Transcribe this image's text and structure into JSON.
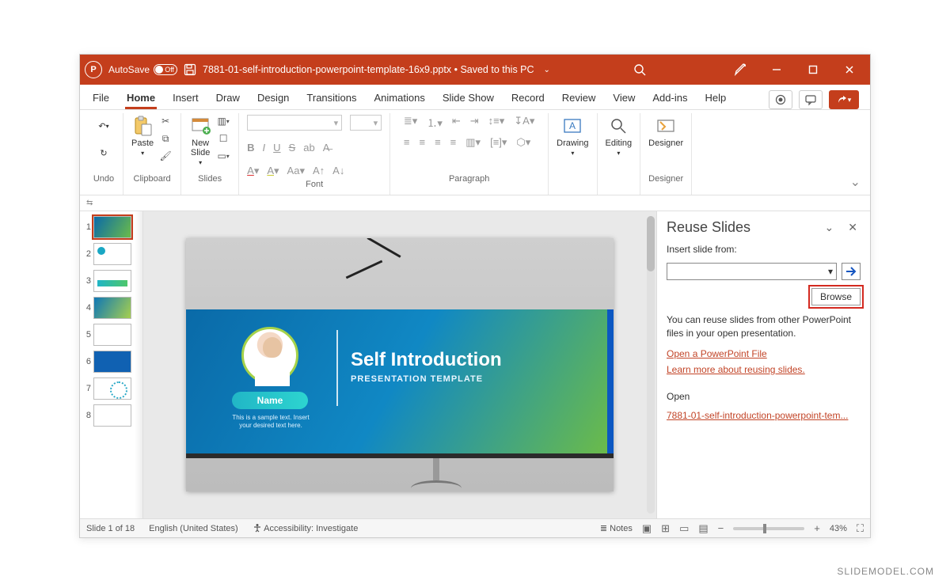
{
  "titlebar": {
    "autosave_label": "AutoSave",
    "autosave_state": "Off",
    "filename": "7881-01-self-introduction-powerpoint-template-16x9.pptx",
    "save_location": "Saved to this PC"
  },
  "tabs": {
    "file": "File",
    "home": "Home",
    "insert": "Insert",
    "draw": "Draw",
    "design": "Design",
    "transitions": "Transitions",
    "animations": "Animations",
    "slideshow": "Slide Show",
    "record": "Record",
    "review": "Review",
    "view": "View",
    "addins": "Add-ins",
    "help": "Help"
  },
  "ribbon": {
    "undo": "Undo",
    "clipboard": "Clipboard",
    "paste": "Paste",
    "slides": "Slides",
    "new_slide": "New\nSlide",
    "font": "Font",
    "paragraph": "Paragraph",
    "drawing": "Drawing",
    "editing": "Editing",
    "designer_group": "Designer",
    "designer_btn": "Designer"
  },
  "thumbs": [
    "1",
    "2",
    "3",
    "4",
    "5",
    "6",
    "7",
    "8"
  ],
  "slide": {
    "title": "Self Introduction",
    "subtitle": "PRESENTATION TEMPLATE",
    "name_pill": "Name",
    "sample": "This is a sample text. Insert your desired text here."
  },
  "pane": {
    "title": "Reuse Slides",
    "field_label": "Insert slide from:",
    "browse": "Browse",
    "hint": "You can reuse slides from other PowerPoint files in your open presentation.",
    "link_open_file": "Open a PowerPoint File",
    "link_learn": "Learn more about reusing slides.",
    "open_label": "Open",
    "open_file": "7881-01-self-introduction-powerpoint-tem..."
  },
  "statusbar": {
    "slide_pos": "Slide 1 of 18",
    "language": "English (United States)",
    "accessibility": "Accessibility: Investigate",
    "notes": "Notes",
    "zoom": "43%"
  },
  "watermark": "SLIDEMODEL.COM"
}
